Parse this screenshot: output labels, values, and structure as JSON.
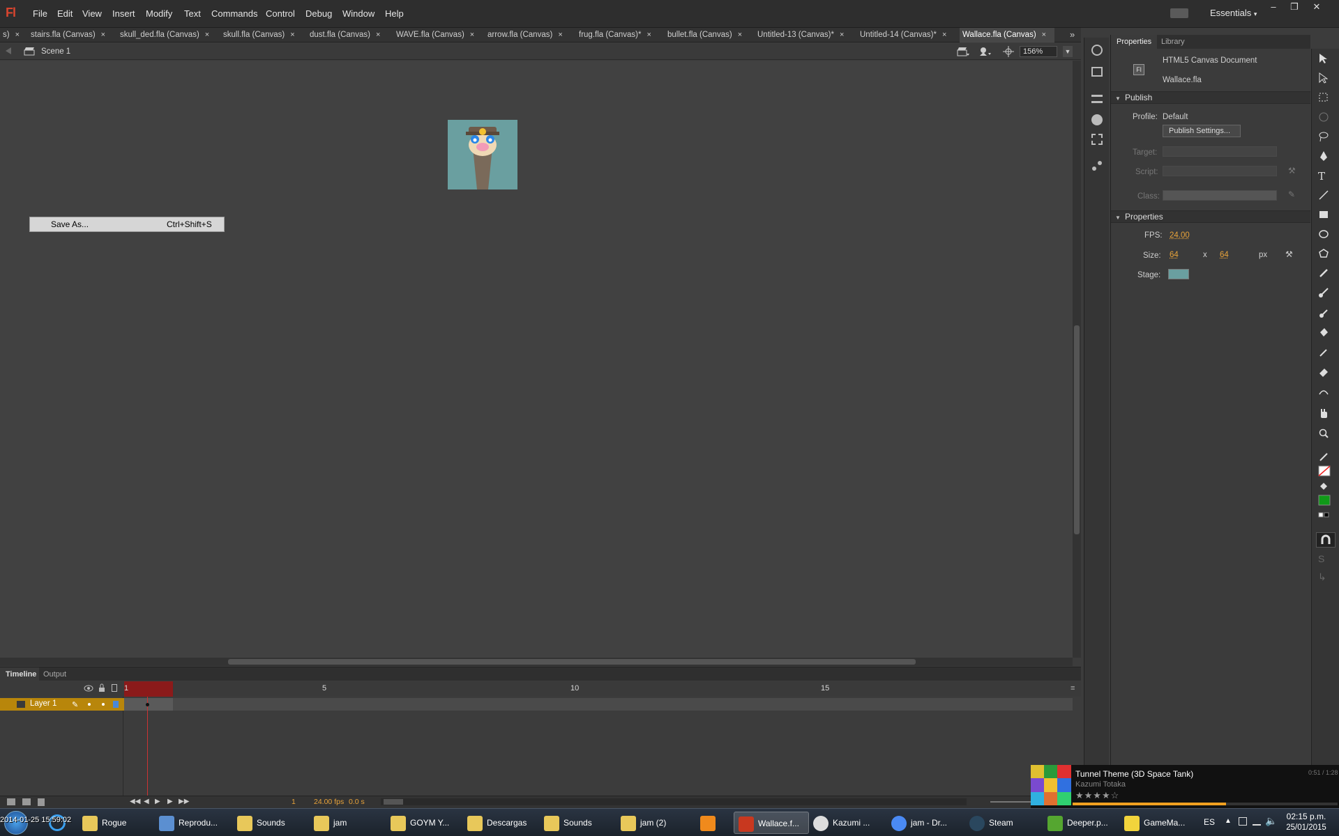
{
  "app": {
    "logo": "Fl",
    "workspace": "Essentials"
  },
  "menu": [
    "File",
    "Edit",
    "View",
    "Insert",
    "Modify",
    "Text",
    "Commands",
    "Control",
    "Debug",
    "Window",
    "Help"
  ],
  "window_buttons": [
    "–",
    "❐",
    "✕"
  ],
  "tabs": [
    {
      "label": "s)"
    },
    {
      "label": "stairs.fla (Canvas)"
    },
    {
      "label": "skull_ded.fla (Canvas)"
    },
    {
      "label": "skull.fla (Canvas)"
    },
    {
      "label": "dust.fla (Canvas)"
    },
    {
      "label": "WAVE.fla (Canvas)"
    },
    {
      "label": "arrow.fla (Canvas)"
    },
    {
      "label": "frug.fla (Canvas)*"
    },
    {
      "label": "bullet.fla (Canvas)"
    },
    {
      "label": "Untitled-13 (Canvas)*"
    },
    {
      "label": "Untitled-14 (Canvas)*"
    },
    {
      "label": "Wallace.fla (Canvas)"
    }
  ],
  "tab_close": "×",
  "tabs_overflow": "»",
  "editbar": {
    "scene": "Scene 1",
    "zoom": "156%"
  },
  "context_menu": {
    "label": "Save As...",
    "shortcut": "Ctrl+Shift+S"
  },
  "timeline": {
    "tabs": [
      "Timeline",
      "Output"
    ],
    "ruler": [
      "1",
      "5",
      "10",
      "15"
    ],
    "layer": "Layer 1",
    "frame": "1",
    "fps": "24.00 fps",
    "time": "0.0 s"
  },
  "properties": {
    "tabs": [
      "Properties",
      "Library"
    ],
    "doc_type": "HTML5 Canvas Document",
    "file": "Wallace.fla",
    "publish_header": "Publish",
    "profile_label": "Profile:",
    "profile_value": "Default",
    "publish_settings": "Publish Settings...",
    "target_label": "Target:",
    "script_label": "Script:",
    "class_label": "Class:",
    "properties_header": "Properties",
    "fps_label": "FPS:",
    "fps_value": "24.00",
    "size_label": "Size:",
    "width": "64",
    "x_sep": "x",
    "height": "64",
    "unit": "px",
    "stage_label": "Stage:",
    "stage_color": "#6a9fa0"
  },
  "music": {
    "title": "Tunnel Theme (3D Space Tank)",
    "artist": "Kazumi Totaka",
    "time": "0:51 / 1:28",
    "stars": "★★★★☆",
    "progress": 0.58
  },
  "taskbar": {
    "items": [
      {
        "label": "Rogue",
        "icon": "folder-icon",
        "color": "#e8c85a"
      },
      {
        "label": "Reprodu...",
        "icon": "media-player-icon",
        "color": "#5b8fd1"
      },
      {
        "label": "Sounds",
        "icon": "folder-icon",
        "color": "#e8c85a"
      },
      {
        "label": "jam",
        "icon": "folder-icon",
        "color": "#e8c85a"
      },
      {
        "label": "GOYM Y...",
        "icon": "folder-icon",
        "color": "#e8c85a"
      },
      {
        "label": "Descargas",
        "icon": "downloads-folder-icon",
        "color": "#e8c85a"
      },
      {
        "label": "Sounds",
        "icon": "folder-icon",
        "color": "#e8c85a"
      },
      {
        "label": "jam (2)",
        "icon": "folder-icon",
        "color": "#e8c85a"
      },
      {
        "label": "",
        "icon": "vlc-icon",
        "color": "#f08a1c"
      },
      {
        "label": "Wallace.f...",
        "icon": "flash-icon",
        "color": "#c8381f"
      },
      {
        "label": "Kazumi ...",
        "icon": "music-player-icon",
        "color": "#ddd"
      },
      {
        "label": "jam - Dr...",
        "icon": "chrome-icon",
        "color": "#4a8af4"
      },
      {
        "label": "Steam",
        "icon": "steam-icon",
        "color": "#2a475e"
      },
      {
        "label": "Deeper.p...",
        "icon": "gamemaker-icon",
        "color": "#55a630"
      },
      {
        "label": "GameMa...",
        "icon": "gamemaker-help-icon",
        "color": "#f2d43c"
      }
    ],
    "lang": "ES",
    "time": "02:15 p.m.",
    "date": "25/01/2015",
    "overlay_text": "2014-01-25 15:59:02"
  }
}
